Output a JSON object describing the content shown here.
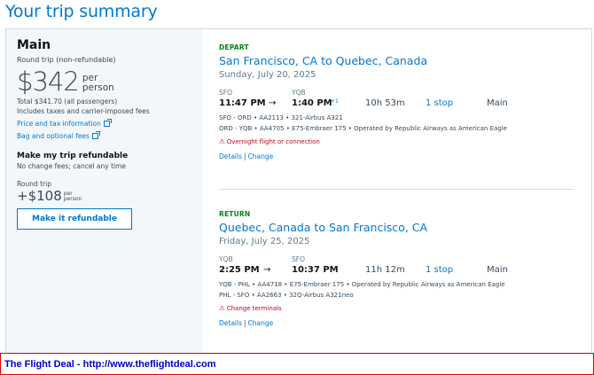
{
  "page": {
    "title": "Your trip summary"
  },
  "fare": {
    "name": "Main",
    "type": "Round trip (non-refundable)",
    "price": "$342",
    "per_line1": "per",
    "per_line2": "person",
    "total": "Total $341.70 (all passengers)",
    "includes": "Includes taxes and carrier-imposed fees",
    "price_info_link": "Price and tax information",
    "bag_fees_link": "Bag and optional fees",
    "refund_title": "Make my trip refundable",
    "refund_sub": "No change fees; cancel any time",
    "refund_rt_label": "Round trip",
    "refund_price": "+$108",
    "refund_per_line1": "per",
    "refund_per_line2": "person",
    "refund_button": "Make it refundable"
  },
  "segments": {
    "depart": {
      "label": "DEPART",
      "route": "San Francisco, CA to Quebec, Canada",
      "date": "Sunday, July 20, 2025",
      "from_code": "SFO",
      "to_code": "YQB",
      "dep_time": "11:47 PM",
      "arrow": "→",
      "arr_time": "1:40 PM",
      "arr_plus": "+1",
      "duration": "10h 53m",
      "stops": "1 stop",
      "cabin": "Main",
      "legs": [
        "SFO - ORD • AA2113 • 321-Airbus A321",
        "ORD - YQB • AA4705 • E75-Embraer 175 • Operated by Republic Airways as American Eagle"
      ],
      "warning": "Overnight flight or connection",
      "details_link": "Details",
      "change_link": "Change"
    },
    "return": {
      "label": "RETURN",
      "route": "Quebec, Canada to San Francisco, CA",
      "date": "Friday, July 25, 2025",
      "from_code": "YQB",
      "to_code": "SFO",
      "dep_time": "2:25 PM",
      "arrow": "→",
      "arr_time": "10:37 PM",
      "duration": "11h 12m",
      "stops": "1 stop",
      "cabin": "Main",
      "legs": [
        "YQB - PHL • AA4718 • E75-Embraer 175 • Operated by Republic Airways as American Eagle",
        "PHL - SFO • AA2663 • 32Q-Airbus A321neo"
      ],
      "warning": "Change terminals",
      "details_link": "Details",
      "change_link": "Change"
    }
  },
  "banner": {
    "text": "The Flight Deal - http://www.theflightdeal.com"
  },
  "colors": {
    "brand_blue": "#0078d2",
    "depart_green": "#008712",
    "warning_red": "#c30019",
    "banner_border": "#e00000"
  },
  "icons": {
    "external_link": "external-link-icon",
    "warning": "warning-triangle-icon"
  }
}
